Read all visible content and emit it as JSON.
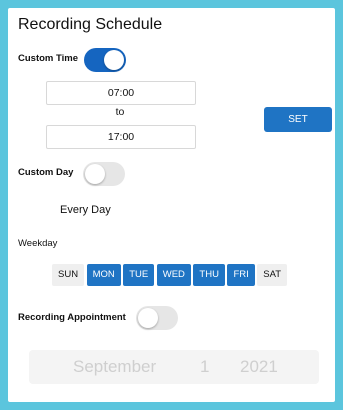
{
  "title": "Recording Schedule",
  "custom_time": {
    "label": "Custom Time",
    "enabled": true
  },
  "time_range": {
    "start": "07:00",
    "separator": "to",
    "end": "17:00"
  },
  "set_button": "SET",
  "custom_day": {
    "label": "Custom Day",
    "enabled": false,
    "summary": "Every Day"
  },
  "weekday": {
    "label": "Weekday",
    "days": [
      {
        "label": "SUN",
        "selected": false
      },
      {
        "label": "MON",
        "selected": true
      },
      {
        "label": "TUE",
        "selected": true
      },
      {
        "label": "WED",
        "selected": true
      },
      {
        "label": "THU",
        "selected": true
      },
      {
        "label": "FRI",
        "selected": true
      },
      {
        "label": "SAT",
        "selected": false
      }
    ]
  },
  "appointment": {
    "label": "Recording Appointment",
    "enabled": false
  },
  "date_picker": {
    "month": "September",
    "day": "1",
    "year": "2021"
  },
  "colors": {
    "accent": "#1f74c4",
    "toggle_on": "#1565c0",
    "background": "#5bc5dd"
  }
}
